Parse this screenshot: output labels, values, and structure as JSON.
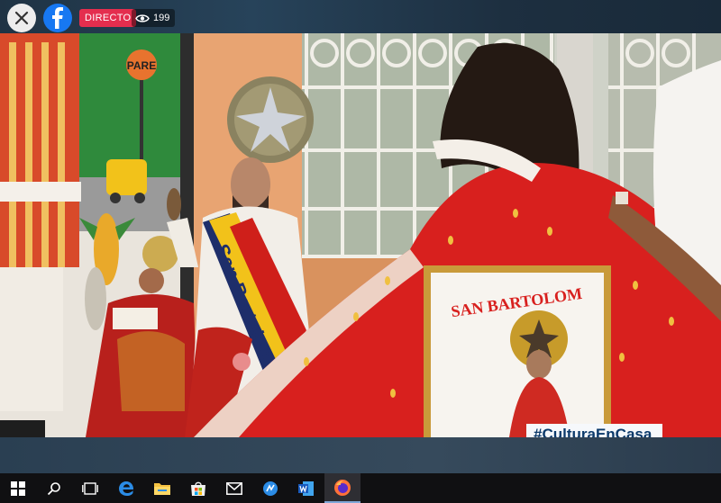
{
  "live_bar": {
    "live_label": "DIRECTO",
    "viewer_count": "199"
  },
  "video": {
    "cape_text": "SAN BARTOLOM",
    "sign_text": "PARE",
    "statue_sash_text": "San Bartolomé",
    "hashtag": "#CulturaEnCasa"
  },
  "taskbar": {
    "icons": [
      "windows-start-icon",
      "search-icon",
      "task-view-icon",
      "edge-icon",
      "file-explorer-icon",
      "store-icon",
      "mail-icon",
      "unknown-app-icon",
      "word-icon",
      "firefox-icon"
    ]
  },
  "colors": {
    "live_red": "#e42e4e",
    "facebook_blue": "#1778f2",
    "hashtag_text": "#0c3a6b",
    "cape_red": "#d8201e"
  }
}
